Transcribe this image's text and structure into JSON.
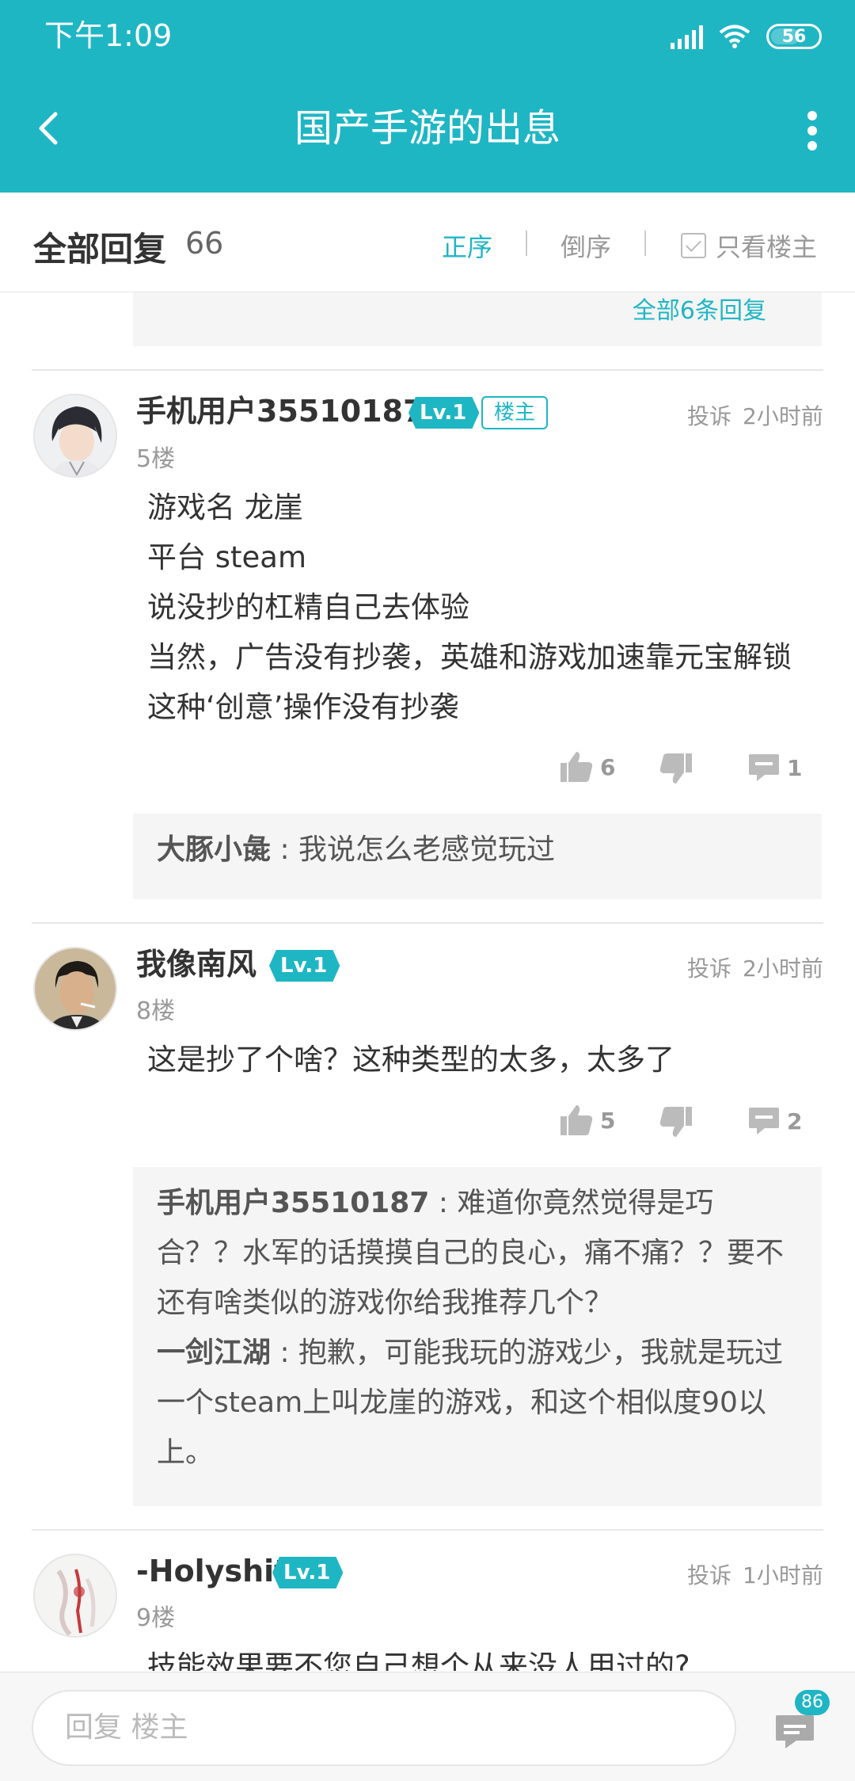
{
  "status_bar": {
    "time": "下午1:09",
    "battery": "56"
  },
  "nav": {
    "title": "国产手游的出息",
    "back_icon": "chevron-left-icon",
    "more_icon": "more-vertical-icon"
  },
  "sort_bar": {
    "title": "全部回复",
    "count": "66",
    "asc": "正序",
    "desc": "倒序",
    "only_op": "只看楼主"
  },
  "prev_post": {
    "more_replies": "全部6条回复"
  },
  "posts": [
    {
      "username": "手机用户35510187",
      "level": "Lv.1",
      "op_badge": "楼主",
      "floor": "5楼",
      "report": "投诉",
      "time": "2小时前",
      "lines": [
        "游戏名 龙崖",
        "平台 steam",
        "说没抄的杠精自己去体验",
        "当然，广告没有抄袭，英雄和游戏加速靠元宝解锁",
        "这种‘创意’操作没有抄袭"
      ],
      "likes": "6",
      "comments": "1",
      "replies": [
        {
          "user": "大豚小彘",
          "sep": " : ",
          "text": "我说怎么老感觉玩过"
        }
      ]
    },
    {
      "username": "我像南风",
      "level": "Lv.1",
      "floor": "8楼",
      "report": "投诉",
      "time": "2小时前",
      "lines": [
        "这是抄了个啥？这种类型的太多，太多了"
      ],
      "likes": "5",
      "comments": "2",
      "replies": [
        {
          "user": "手机用户35510187",
          "sep": " : ",
          "text": "难道你竟然觉得是巧合？？水军的话摸摸自己的良心，痛不痛？？要不还有啥类似的游戏你给我推荐几个？"
        },
        {
          "user": "一剑江湖",
          "sep": " : ",
          "text": "抱歉，可能我玩的游戏少，我就是玩过一个steam上叫龙崖的游戏，和这个相似度90以上。"
        }
      ]
    },
    {
      "username": "-Holyshit",
      "level": "Lv.1",
      "floor": "9楼",
      "report": "投诉",
      "time": "1小时前",
      "lines": [
        "技能效果要不您自己想个从来没人用过的?"
      ]
    }
  ],
  "bottom_bar": {
    "placeholder": "回复  楼主",
    "message_count": "86"
  },
  "colors": {
    "accent": "#1fb6c4",
    "text": "#333333",
    "muted": "#999999",
    "reply_bg": "#f5f5f5"
  }
}
